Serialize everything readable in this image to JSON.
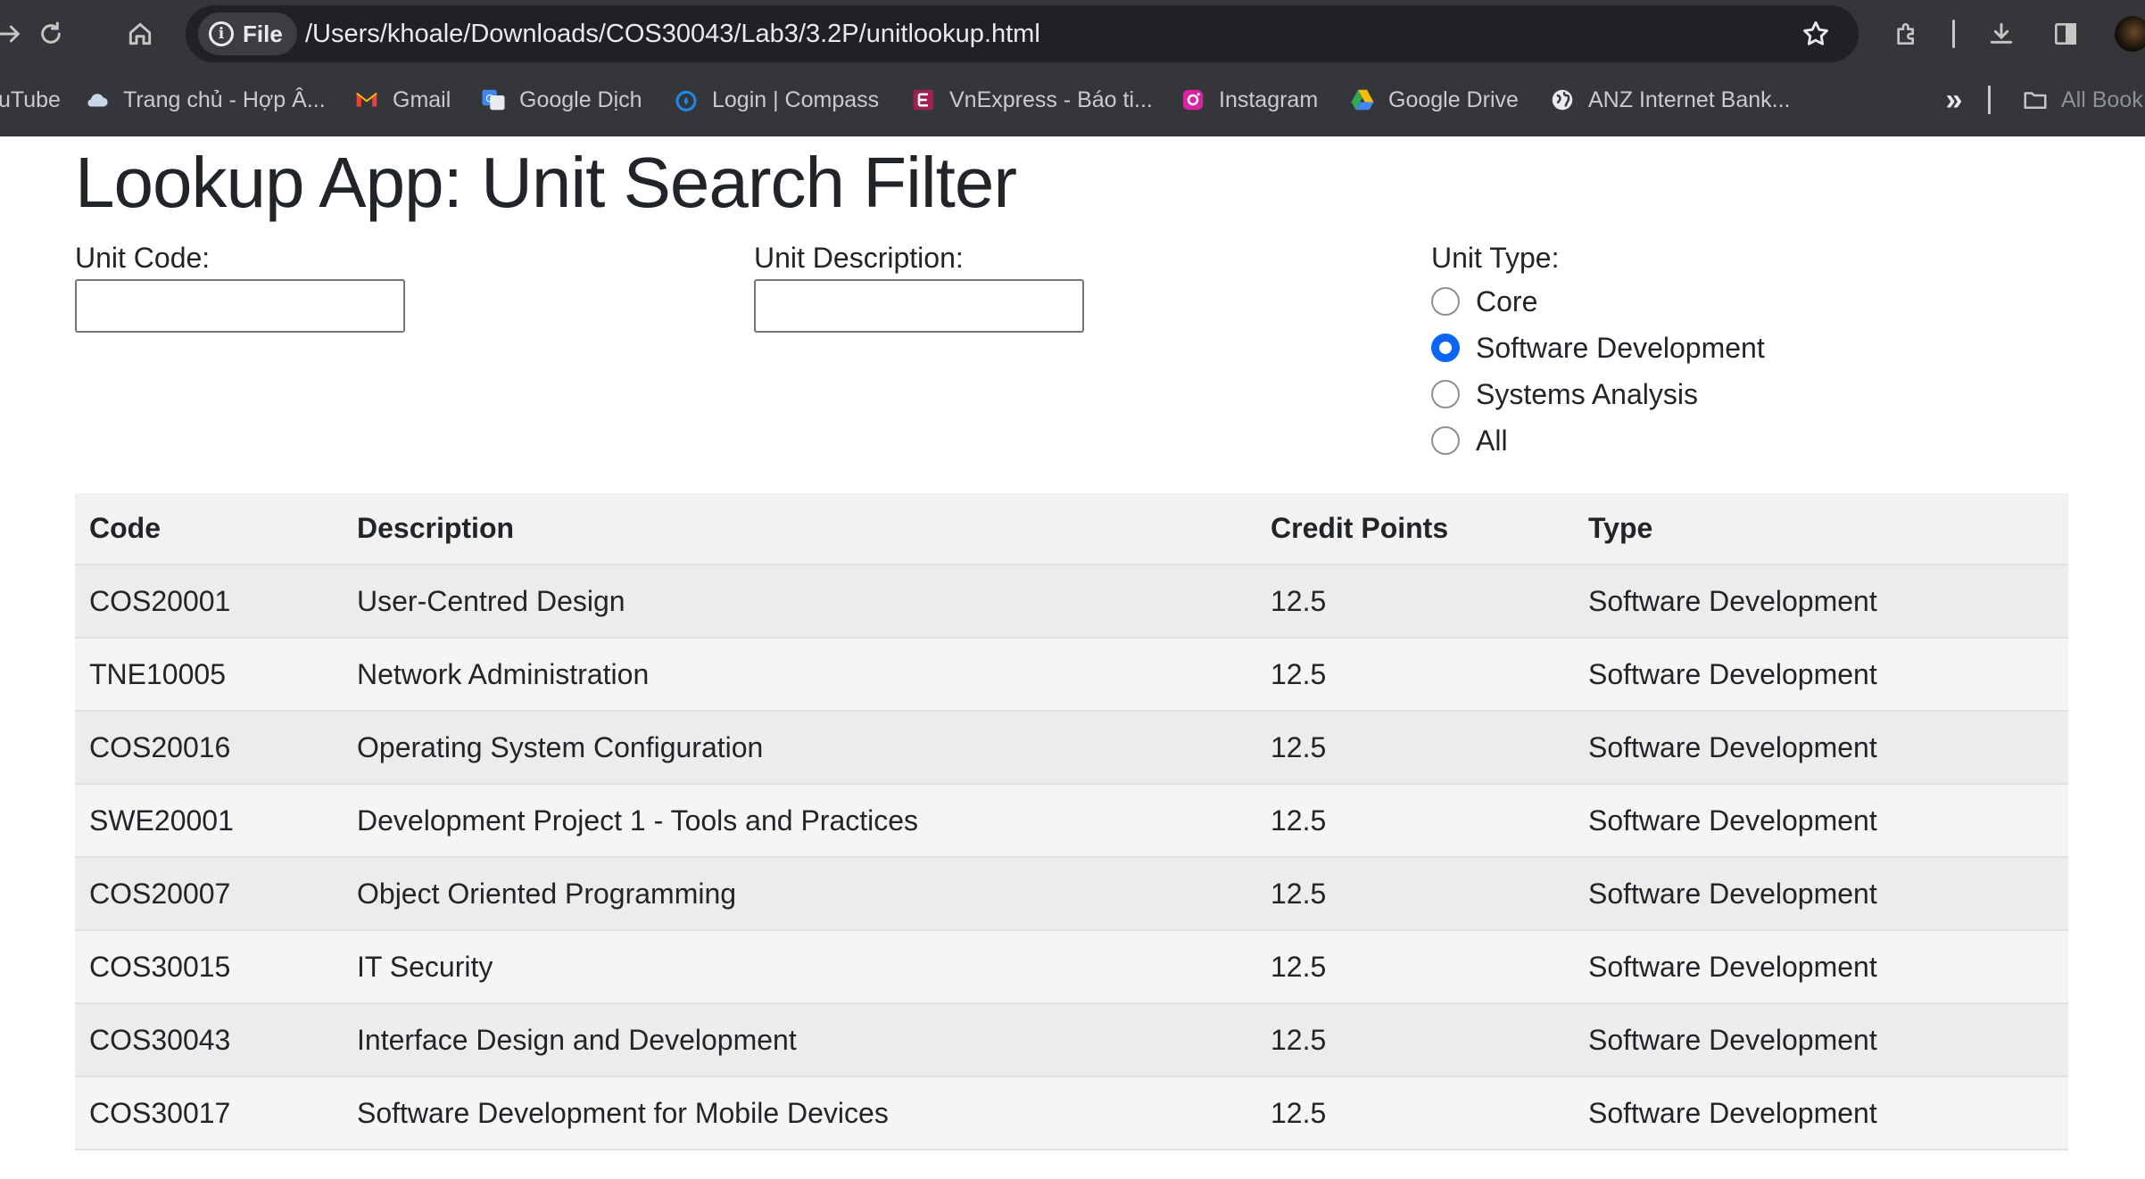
{
  "browser": {
    "site_chip": "File",
    "url": "/Users/khoale/Downloads/COS30043/Lab3/3.2P/unitlookup.html",
    "bookmarks": [
      {
        "label": "uTube",
        "icon": "youtube-icon"
      },
      {
        "label": "Trang chủ - Hợp Â...",
        "icon": "cloud-icon"
      },
      {
        "label": "Gmail",
        "icon": "gmail-icon"
      },
      {
        "label": "Google Dịch",
        "icon": "google-translate-icon"
      },
      {
        "label": "Login | Compass",
        "icon": "compass-icon"
      },
      {
        "label": "VnExpress - Báo ti...",
        "icon": "vnexpress-icon"
      },
      {
        "label": "Instagram",
        "icon": "instagram-icon"
      },
      {
        "label": "Google Drive",
        "icon": "google-drive-icon"
      },
      {
        "label": "ANZ Internet Bank...",
        "icon": "globe-icon"
      }
    ],
    "more_bookmarks": "»",
    "all_bookmarks": "All Book"
  },
  "page": {
    "title": "Lookup App: Unit Search Filter",
    "unit_code_label": "Unit Code:",
    "unit_code_value": "",
    "unit_desc_label": "Unit Description:",
    "unit_desc_value": "",
    "unit_type_label": "Unit Type:",
    "unit_type_options": [
      "Core",
      "Software Development",
      "Systems Analysis",
      "All"
    ],
    "unit_type_selected": "Software Development"
  },
  "table": {
    "headers": [
      "Code",
      "Description",
      "Credit Points",
      "Type"
    ],
    "rows": [
      [
        "COS20001",
        "User-Centred Design",
        "12.5",
        "Software Development"
      ],
      [
        "TNE10005",
        "Network Administration",
        "12.5",
        "Software Development"
      ],
      [
        "COS20016",
        "Operating System Configuration",
        "12.5",
        "Software Development"
      ],
      [
        "SWE20001",
        "Development Project 1 - Tools and Practices",
        "12.5",
        "Software Development"
      ],
      [
        "COS20007",
        "Object Oriented Programming",
        "12.5",
        "Software Development"
      ],
      [
        "COS30015",
        "IT Security",
        "12.5",
        "Software Development"
      ],
      [
        "COS30043",
        "Interface Design and Development",
        "12.5",
        "Software Development"
      ],
      [
        "COS30017",
        "Software Development for Mobile Devices",
        "12.5",
        "Software Development"
      ]
    ]
  },
  "colors": {
    "chrome_bg": "#35363a",
    "omnibox_bg": "#202124",
    "radio_accent": "#0b65f6",
    "header_bg": "#f2f2f2",
    "row_odd": "#ececec",
    "row_even": "#f5f5f5"
  }
}
